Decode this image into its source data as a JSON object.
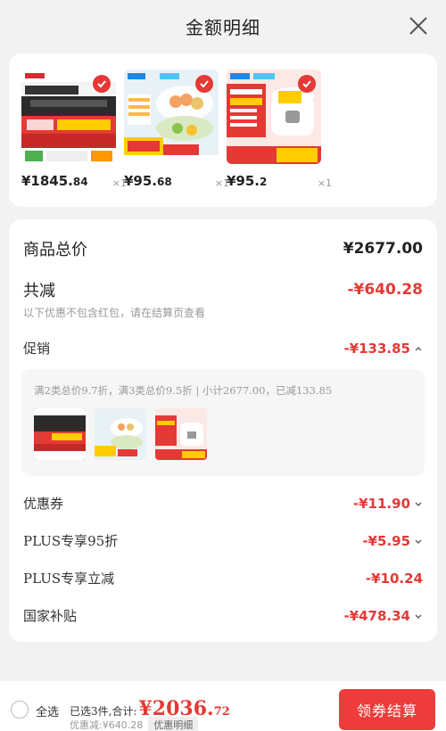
{
  "header": {
    "title": "金额明细"
  },
  "products": [
    {
      "price_main": "¥1845.",
      "price_dec": "84",
      "qty": "×1",
      "image": "range-hood"
    },
    {
      "price_main": "¥95.",
      "price_dec": "68",
      "qty": "×1",
      "image": "food-steamer"
    },
    {
      "price_main": "¥95.",
      "price_dec": "2",
      "qty": "×1",
      "image": "rice-cooker"
    }
  ],
  "summary": {
    "total_label": "商品总价",
    "total_value": "¥2677.00",
    "discount_label": "共减",
    "discount_value": "-¥640.28",
    "discount_note": "以下优惠不包含红包，请在结算页查看",
    "promo_label": "促销",
    "promo_value": "-¥133.85",
    "promo_detail": "满2类总价9.7折，满3类总价9.5折 | 小计2677.00，已减133.85",
    "coupon_label": "优惠券",
    "coupon_value": "-¥11.90",
    "plus95_label": "PLUS专享95折",
    "plus95_value": "-¥5.95",
    "plus_instant_label": "PLUS专享立减",
    "plus_instant_value": "-¥10.24",
    "subsidy_label": "国家补贴",
    "subsidy_value": "-¥478.34"
  },
  "footer": {
    "select_all": "全选",
    "selected_text": "已选3件,合计:",
    "total_main": "¥2036.",
    "total_dec": "72",
    "discount_text": "优惠减:¥640.28",
    "detail_tag": "优惠明细",
    "checkout": "领券结算"
  },
  "colors": {
    "accent": "#e53935",
    "button": "#ee3b3b"
  }
}
